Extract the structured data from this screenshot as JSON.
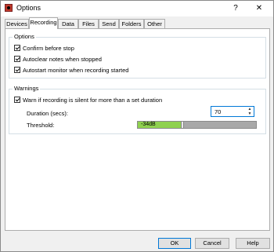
{
  "window": {
    "title": "Options",
    "help_glyph": "?",
    "close_glyph": "✕"
  },
  "tabs": [
    {
      "label": "Devices"
    },
    {
      "label": "Recording"
    },
    {
      "label": "Data"
    },
    {
      "label": "Files"
    },
    {
      "label": "Send"
    },
    {
      "label": "Folders"
    },
    {
      "label": "Other"
    }
  ],
  "options": {
    "group_label": "Options",
    "items": [
      {
        "label": "Confirm before stop",
        "checked": true
      },
      {
        "label": "Autoclear notes when stopped",
        "checked": true
      },
      {
        "label": "Autostart monitor when recording started",
        "checked": true
      }
    ]
  },
  "warnings": {
    "group_label": "Warnings",
    "warn_label": "Warn if recording is silent for more than a set duration",
    "warn_checked": true,
    "duration_label": "Duration (secs):",
    "duration_value": "70",
    "threshold_label": "Threshold:",
    "threshold_value": "-34dB",
    "threshold_level": 0.37
  },
  "buttons": {
    "ok": "OK",
    "cancel": "Cancel",
    "help": "Help"
  }
}
